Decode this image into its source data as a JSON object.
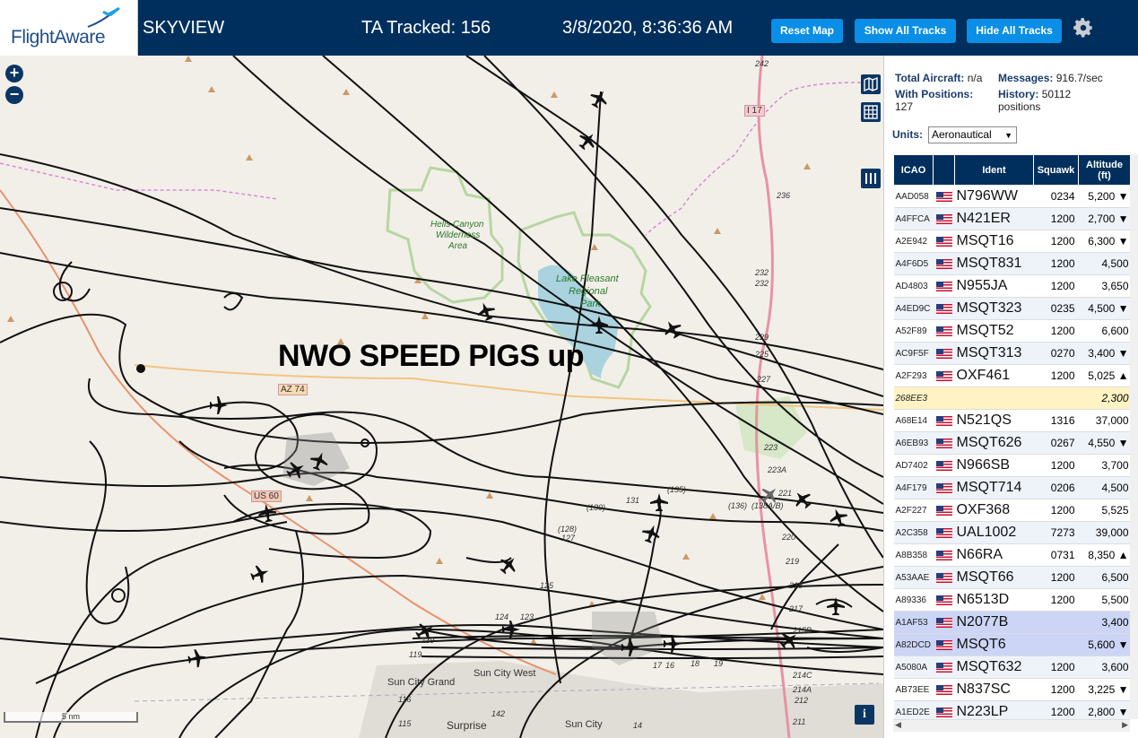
{
  "header": {
    "logo_text": "FlightAware",
    "app_title": "SKYVIEW",
    "tracked": "TA Tracked: 156",
    "clock": "3/8/2020, 8:36:36 AM",
    "buttons": {
      "reset": "Reset Map",
      "show": "Show All Tracks",
      "hide": "Hide All Tracks"
    }
  },
  "map": {
    "zoom_in": "+",
    "zoom_out": "−",
    "overlay_text": "NWO SPEED PIGS up",
    "scale_label": "5 nm",
    "info": "i",
    "labels": {
      "hells_canyon": "Hells Canyon",
      "wilderness": "Wilderness",
      "area": "Area",
      "lake_pleasant": "Lake Pleasant",
      "regional": "Regional",
      "park": "Park",
      "az74": "AZ 74",
      "us60": "US 60",
      "i17": "I 17",
      "sun_city_west": "Sun City West",
      "sun_city_grand": "Sun City Grand",
      "surprise": "Surprise",
      "sun_city": "Sun City",
      "r242": "242",
      "r236": "236",
      "r232a": "232",
      "r232b": "232",
      "r229": "229",
      "r225": "225",
      "r227": "227",
      "r223": "223",
      "r223a": "223A",
      "r221": "221",
      "r220": "220",
      "r219": "219",
      "r218": "218",
      "r217": "217",
      "r215b": "215B",
      "r214c": "214C",
      "r214a": "214A",
      "r212": "212",
      "r211": "211",
      "r136": "(136)",
      "r138": "(138A/B)",
      "r135": "(135)",
      "r131": "131",
      "r130": "(130)",
      "r128": "(128)",
      "r127": "127",
      "r125": "125",
      "r124": "124",
      "r123": "123",
      "r119a": "119",
      "r119b": "119",
      "r116": "116",
      "r115": "115",
      "r142": "142",
      "r17": "17",
      "r16": "16",
      "r18": "18",
      "r19": "19",
      "r14": "14"
    }
  },
  "sidebar": {
    "total_label": "Total Aircraft:",
    "total_value": "n/a",
    "messages_label": "Messages:",
    "messages_value": "916.7/sec",
    "positions_label": "With Positions:",
    "positions_value": "127",
    "history_label": "History:",
    "history_value": "50112",
    "history_unit": "positions",
    "units_label": "Units:",
    "units_value": "Aeronautical",
    "columns": {
      "icao": "ICAO",
      "ident": "Ident",
      "squawk": "Squawk",
      "altitude": "Altitude",
      "altitude_unit": "(ft)"
    },
    "rows": [
      {
        "icao": "AAD058",
        "ident": "N796WW",
        "squawk": "0234",
        "alt": "5,200 ▼"
      },
      {
        "icao": "A4FFCA",
        "ident": "N421ER",
        "squawk": "1200",
        "alt": "2,700 ▼"
      },
      {
        "icao": "A2E942",
        "ident": "MSQT16",
        "squawk": "1200",
        "alt": "6,300 ▼"
      },
      {
        "icao": "A4F6D5",
        "ident": "MSQT831",
        "squawk": "1200",
        "alt": "4,500"
      },
      {
        "icao": "AD4803",
        "ident": "N955JA",
        "squawk": "1200",
        "alt": "3,650"
      },
      {
        "icao": "A4ED9C",
        "ident": "MSQT323",
        "squawk": "0235",
        "alt": "4,500 ▼"
      },
      {
        "icao": "A52F89",
        "ident": "MSQT52",
        "squawk": "1200",
        "alt": "6,600"
      },
      {
        "icao": "AC9F5F",
        "ident": "MSQT313",
        "squawk": "0270",
        "alt": "3,400 ▼"
      },
      {
        "icao": "A2F293",
        "ident": "OXF461",
        "squawk": "1200",
        "alt": "5,025 ▲"
      },
      {
        "icao": "268EE3",
        "ident": "",
        "squawk": "",
        "alt": "2,300",
        "hl": true
      },
      {
        "icao": "A68E14",
        "ident": "N521QS",
        "squawk": "1316",
        "alt": "37,000"
      },
      {
        "icao": "A6EB93",
        "ident": "MSQT626",
        "squawk": "0267",
        "alt": "4,550 ▼"
      },
      {
        "icao": "AD7402",
        "ident": "N966SB",
        "squawk": "1200",
        "alt": "3,700"
      },
      {
        "icao": "A4F179",
        "ident": "MSQT714",
        "squawk": "0206",
        "alt": "4,500"
      },
      {
        "icao": "A2F227",
        "ident": "OXF368",
        "squawk": "1200",
        "alt": "5,525"
      },
      {
        "icao": "A2C358",
        "ident": "UAL1002",
        "squawk": "7273",
        "alt": "39,000"
      },
      {
        "icao": "A8B358",
        "ident": "N66RA",
        "squawk": "0731",
        "alt": "8,350 ▲"
      },
      {
        "icao": "A53AAE",
        "ident": "MSQT66",
        "squawk": "1200",
        "alt": "6,500"
      },
      {
        "icao": "A89336",
        "ident": "N6513D",
        "squawk": "1200",
        "alt": "5,500"
      },
      {
        "icao": "A1AF53",
        "ident": "N2077B",
        "squawk": "",
        "alt": "3,400",
        "sel": true
      },
      {
        "icao": "A82DCD",
        "ident": "MSQT6",
        "squawk": "",
        "alt": "5,600 ▼",
        "sel": true
      },
      {
        "icao": "A5080A",
        "ident": "MSQT632",
        "squawk": "1200",
        "alt": "3,600"
      },
      {
        "icao": "AB73EE",
        "ident": "N837SC",
        "squawk": "1200",
        "alt": "3,225 ▼"
      },
      {
        "icao": "A1ED2E",
        "ident": "N223LP",
        "squawk": "1200",
        "alt": "2,800 ▼"
      }
    ]
  },
  "colors": {
    "header": "#002f5d",
    "button": "#0a8ee6",
    "map_bg": "#f2efe9",
    "lake": "#aad3df",
    "wilderness": "#2a7a2a"
  }
}
